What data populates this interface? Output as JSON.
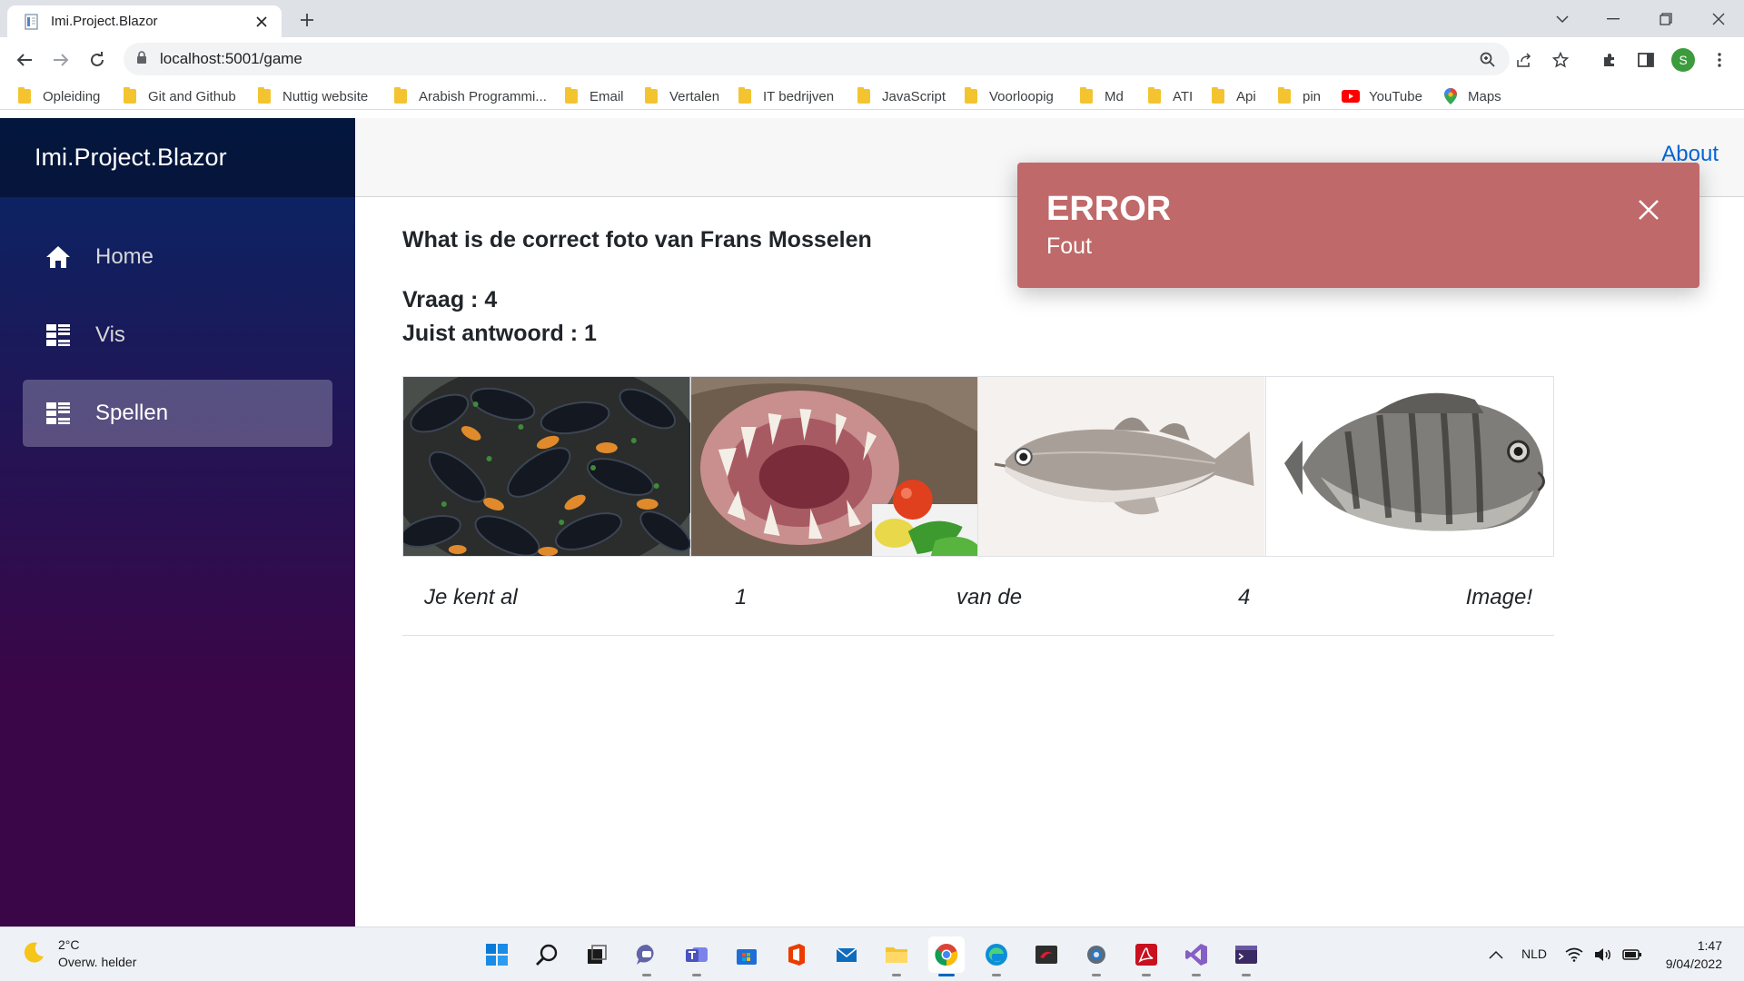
{
  "browser": {
    "tab_title": "Imi.Project.Blazor",
    "url": "localhost:5001/game",
    "profile_initial": "S",
    "bookmarks": [
      {
        "label": "Opleiding",
        "icon": "folder-icon"
      },
      {
        "label": "Git and Github",
        "icon": "folder-icon"
      },
      {
        "label": "Nuttig website",
        "icon": "folder-icon"
      },
      {
        "label": "Arabish Programmi...",
        "icon": "folder-icon"
      },
      {
        "label": "Email",
        "icon": "folder-icon"
      },
      {
        "label": "Vertalen",
        "icon": "folder-icon"
      },
      {
        "label": "IT bedrijven",
        "icon": "folder-icon"
      },
      {
        "label": "JavaScript",
        "icon": "folder-icon"
      },
      {
        "label": "Voorloopig",
        "icon": "folder-icon"
      },
      {
        "label": "Md",
        "icon": "folder-icon"
      },
      {
        "label": "ATI",
        "icon": "folder-icon"
      },
      {
        "label": "Api",
        "icon": "folder-icon"
      },
      {
        "label": "pin",
        "icon": "folder-icon"
      },
      {
        "label": "YouTube",
        "icon": "youtube-icon"
      },
      {
        "label": "Maps",
        "icon": "maps-icon"
      }
    ]
  },
  "app": {
    "brand": "Imi.Project.Blazor",
    "nav": [
      {
        "label": "Home",
        "icon": "home-icon",
        "active": false
      },
      {
        "label": "Vis",
        "icon": "list-icon",
        "active": false
      },
      {
        "label": "Spellen",
        "icon": "list-icon",
        "active": true
      }
    ],
    "about_link": "About"
  },
  "game": {
    "question": "What is de correct foto van Frans Mosselen",
    "vraag": "Vraag : 4",
    "juist": "Juist antwoord : 1",
    "images": [
      {
        "subject": "mussels"
      },
      {
        "subject": "anglerfish"
      },
      {
        "subject": "whiting-fish"
      },
      {
        "subject": "striped-fish"
      }
    ],
    "score_line": {
      "part1": "Je kent al",
      "known": "1",
      "part2": "van de",
      "total": "4",
      "part3": "Image!"
    }
  },
  "toast": {
    "title": "ERROR",
    "message": "Fout",
    "color": "#c0696a"
  },
  "taskbar": {
    "weather_temp": "2°C",
    "weather_desc": "Overw. helder",
    "apps": [
      "windows-start-icon",
      "search-icon",
      "task-view-icon",
      "teams-chat-icon",
      "teams-icon",
      "store-icon",
      "office-icon",
      "mail-icon",
      "file-explorer-icon",
      "chrome-icon",
      "edge-icon",
      "app-icon",
      "settings-icon",
      "acrobat-icon",
      "visual-studio-icon",
      "terminal-icon"
    ],
    "language": "NLD",
    "time": "1:47",
    "date": "9/04/2022"
  }
}
